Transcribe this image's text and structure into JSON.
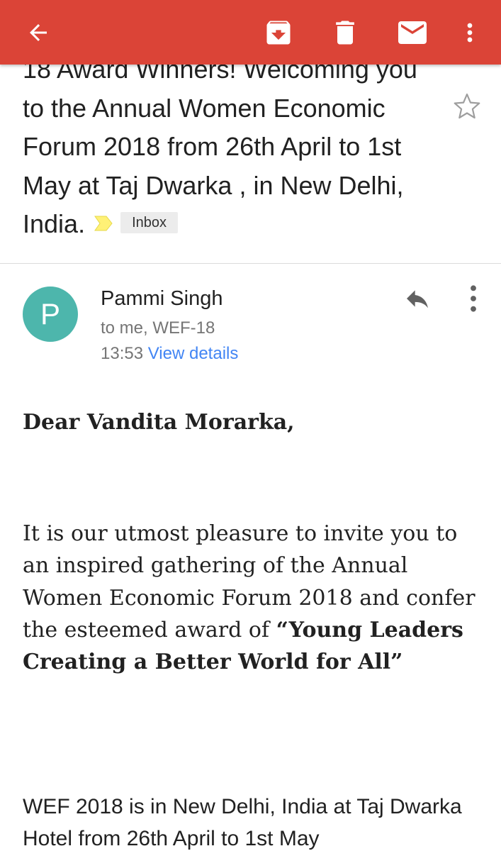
{
  "email": {
    "subject_first_line": "18 Award Winners! Welcoming",
    "subject_rest": "you to the Annual Women Economic Forum 2018 from 26th April to 1st May at Taj Dwarka , in New Delhi, India.",
    "label": "Inbox",
    "sender": {
      "initial": "P",
      "name": "Pammi Singh",
      "recipients": "to me, WEF-18",
      "time": "13:53",
      "view_details": "View details",
      "avatar_color": "#4db6ac"
    },
    "body": {
      "greeting": "Dear Vandita Morarka,",
      "p1_text": "It is our utmost pleasure to invite you to an inspired gathering of the Annual Women Economic Forum 2018 and confer the esteemed award of ",
      "p1_bold": "“Young Leaders Creating a Better World for All”",
      "p2_text": "WEF 2018 is in New Delhi, India at Taj Dwarka Hotel from 26th April to 1st May"
    }
  },
  "toolbar": {
    "color": "#db4437",
    "icons": [
      "arrow-back-icon",
      "archive-icon",
      "delete-icon",
      "mark-unread-icon",
      "more-vert-icon"
    ]
  },
  "colors": {
    "link": "#4285f4",
    "importance_marker": "#fff176",
    "secondary_text": "#757575"
  }
}
